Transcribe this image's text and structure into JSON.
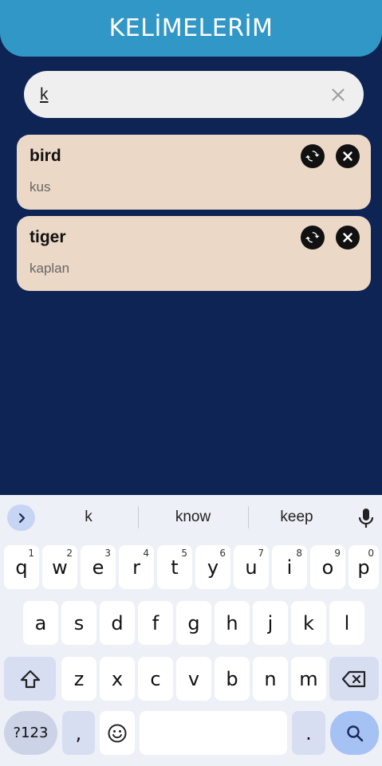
{
  "app": {
    "title": "KELİMELERİM"
  },
  "search": {
    "value": "k"
  },
  "words": [
    {
      "word": "bird",
      "meaning": "kus"
    },
    {
      "word": "tiger",
      "meaning": "kaplan"
    }
  ],
  "keyboard": {
    "suggestions": [
      "k",
      "know",
      "keep"
    ],
    "row1": [
      {
        "l": "q",
        "n": "1"
      },
      {
        "l": "w",
        "n": "2"
      },
      {
        "l": "e",
        "n": "3"
      },
      {
        "l": "r",
        "n": "4"
      },
      {
        "l": "t",
        "n": "5"
      },
      {
        "l": "y",
        "n": "6"
      },
      {
        "l": "u",
        "n": "7"
      },
      {
        "l": "i",
        "n": "8"
      },
      {
        "l": "o",
        "n": "9"
      },
      {
        "l": "p",
        "n": "0"
      }
    ],
    "row2": [
      "a",
      "s",
      "d",
      "f",
      "g",
      "h",
      "j",
      "k",
      "l"
    ],
    "row3": [
      "z",
      "x",
      "c",
      "v",
      "b",
      "n",
      "m"
    ],
    "symbols_label": "?123",
    "comma": ",",
    "period": "."
  },
  "colors": {
    "background": "#0e2454",
    "app_bar": "#3197c6",
    "card": "#ecd8c6"
  }
}
